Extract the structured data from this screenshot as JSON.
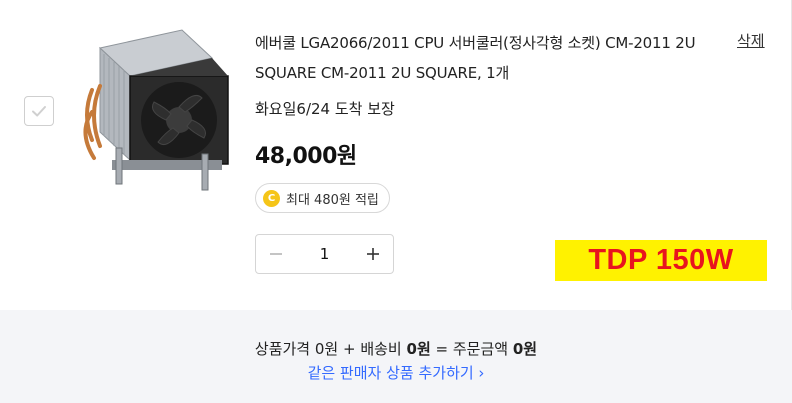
{
  "item": {
    "title": "에버쿨 LGA2066/2011 CPU 서버쿨러(정사각형 소켓) CM-2011 2U SQUARE CM-2011 2U SQUARE, 1개",
    "delete_label": "삭제",
    "delivery": "화요일6/24 도착 보장",
    "price": "48,000원",
    "reward_coin": "C",
    "reward_text": "최대 480원 적립",
    "quantity": "1",
    "checked": false,
    "image_icon": "cpu-cooler-icon"
  },
  "overlay": {
    "tdp_label": "TDP 150W",
    "bg_color": "#fff200",
    "text_color": "#e8141e"
  },
  "summary": {
    "product_price_label": "상품가격",
    "product_price": "0원",
    "shipping_label": "배송비",
    "shipping": "0원",
    "order_total_label": "주문금액",
    "order_total": "0원",
    "more_link": "같은 판매자 상품 추가하기 ›"
  },
  "colors": {
    "link": "#346aff",
    "summary_bg": "#f4f5f8",
    "coin": "#f5c518"
  }
}
